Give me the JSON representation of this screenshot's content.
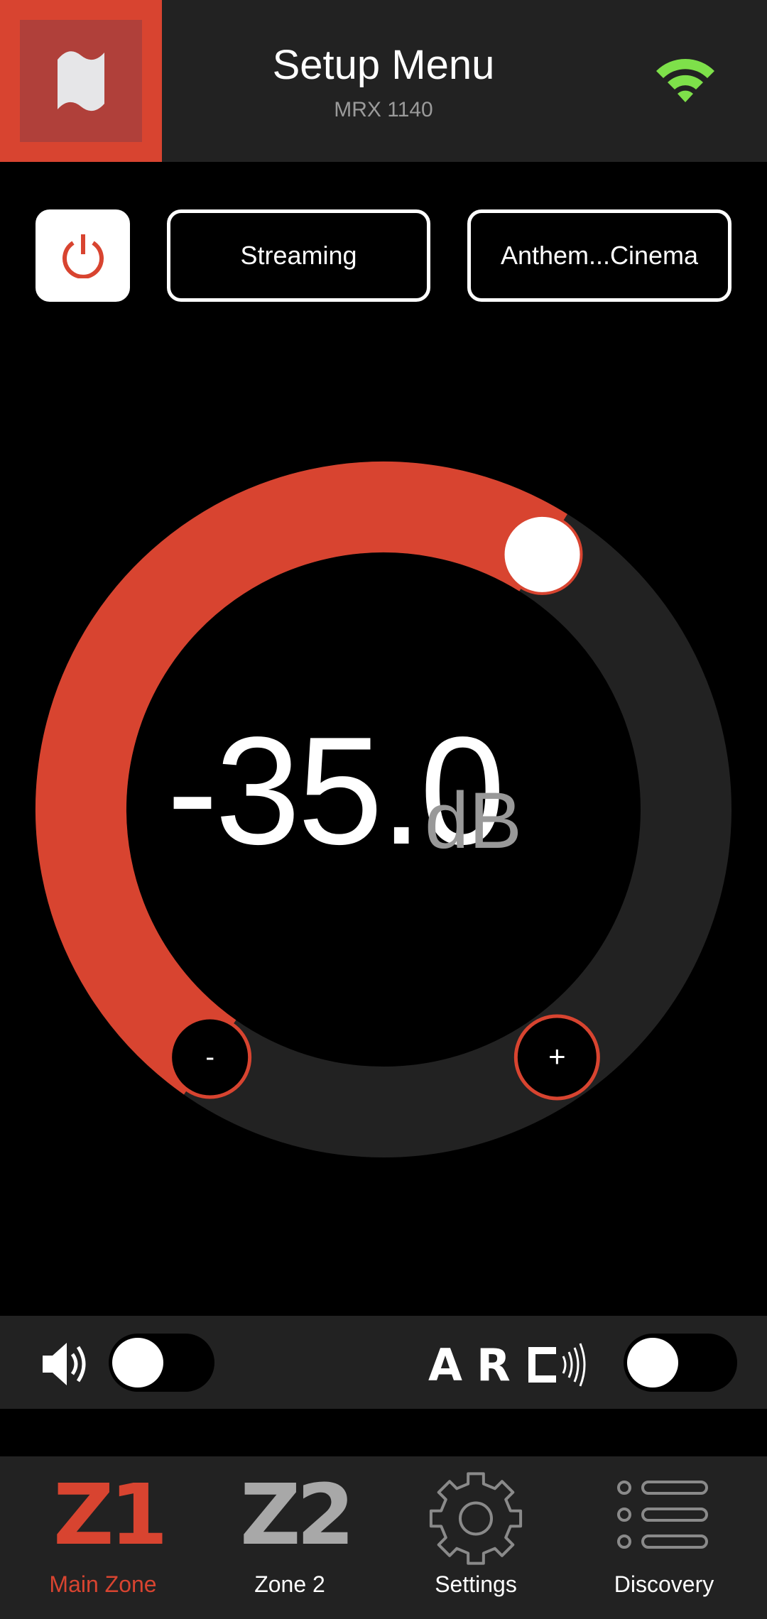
{
  "header": {
    "title": "Setup Menu",
    "subtitle": "MRX 1140",
    "flag_icon": "flag-icon",
    "wifi_icon": "wifi-icon",
    "wifi_color": "#7ee04a"
  },
  "controls": {
    "power_icon": "power-icon",
    "source_label": "Streaming",
    "preset_label": "Anthem...Cinema"
  },
  "volume": {
    "value": "-35.0",
    "unit": "dB",
    "level_fraction": 0.61,
    "minus_label": "-",
    "plus_label": "+",
    "accent": "#d84430",
    "track": "#222222"
  },
  "toggles": {
    "mute": {
      "icon": "speaker-icon",
      "on": false
    },
    "arc": {
      "logo": "ARC",
      "on": false
    }
  },
  "nav": {
    "items": [
      {
        "icon_text": "Z1",
        "label": "Main Zone",
        "active": true
      },
      {
        "icon_text": "Z2",
        "label": "Zone 2",
        "active": false
      },
      {
        "icon": "gear-icon",
        "label": "Settings",
        "active": false
      },
      {
        "icon": "list-icon",
        "label": "Discovery",
        "active": false
      }
    ]
  }
}
